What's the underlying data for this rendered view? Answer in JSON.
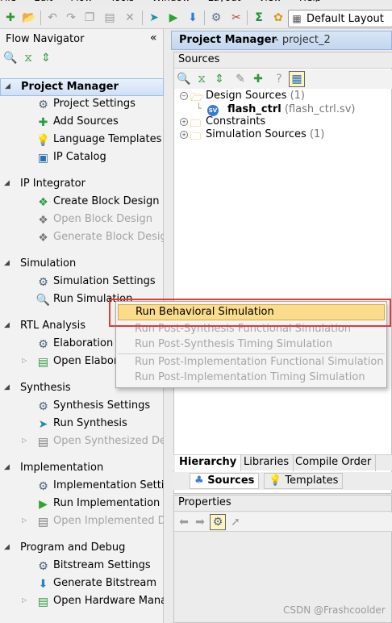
{
  "menubar": [
    "File",
    "Edit",
    "Flow",
    "Tools",
    "Window",
    "Layout",
    "View",
    "Help"
  ],
  "toolbar": {
    "layout_select": "Default Layout",
    "icons": [
      "new-project-icon",
      "open-project-icon",
      "undo-icon",
      "redo-icon",
      "copy-icon",
      "paste-icon",
      "delete-icon",
      "run-flow-icon",
      "run-icon",
      "program-icon",
      "settings-icon",
      "tools-icon",
      "sigma-icon",
      "layout-icon"
    ]
  },
  "flow_navigator": {
    "title": "Flow Navigator",
    "collapse_glyph": "«",
    "sections": [
      {
        "title": "Project Manager",
        "active": true,
        "items": [
          {
            "label": "Project Settings",
            "icon": "gear-icon",
            "enabled": true
          },
          {
            "label": "Add Sources",
            "icon": "add-sources-icon",
            "enabled": true
          },
          {
            "label": "Language Templates",
            "icon": "lightbulb-icon",
            "enabled": true
          },
          {
            "label": "IP Catalog",
            "icon": "ip-catalog-icon",
            "enabled": true
          }
        ]
      },
      {
        "title": "IP Integrator",
        "items": [
          {
            "label": "Create Block Design",
            "icon": "create-block-icon",
            "enabled": true
          },
          {
            "label": "Open Block Design",
            "icon": "open-block-icon",
            "enabled": false
          },
          {
            "label": "Generate Block Design",
            "icon": "generate-block-icon",
            "enabled": false
          }
        ]
      },
      {
        "title": "Simulation",
        "items": [
          {
            "label": "Simulation Settings",
            "icon": "gear-icon",
            "enabled": true
          },
          {
            "label": "Run Simulation",
            "icon": "magnifier-wave-icon",
            "enabled": true
          }
        ]
      },
      {
        "title": "RTL Analysis",
        "items": [
          {
            "label": "Elaboration Settings",
            "icon": "gear-icon",
            "enabled": true
          },
          {
            "label": "Open Elaborated Design",
            "icon": "open-design-icon",
            "enabled": true,
            "expandable": true
          }
        ]
      },
      {
        "title": "Synthesis",
        "items": [
          {
            "label": "Synthesis Settings",
            "icon": "gear-icon",
            "enabled": true
          },
          {
            "label": "Run Synthesis",
            "icon": "run-synthesis-icon",
            "enabled": true
          },
          {
            "label": "Open Synthesized Design",
            "icon": "open-design-icon",
            "enabled": false,
            "expandable": true
          }
        ]
      },
      {
        "title": "Implementation",
        "items": [
          {
            "label": "Implementation Settings",
            "icon": "gear-icon",
            "enabled": true
          },
          {
            "label": "Run Implementation",
            "icon": "run-icon",
            "enabled": true
          },
          {
            "label": "Open Implemented Design",
            "icon": "open-design-icon",
            "enabled": false,
            "expandable": true
          }
        ]
      },
      {
        "title": "Program and Debug",
        "items": [
          {
            "label": "Bitstream Settings",
            "icon": "gear-icon",
            "enabled": true
          },
          {
            "label": "Generate Bitstream",
            "icon": "generate-bitstream-icon",
            "enabled": true
          },
          {
            "label": "Open Hardware Manager",
            "icon": "hardware-manager-icon",
            "enabled": true,
            "expandable": true
          }
        ]
      }
    ]
  },
  "project_manager": {
    "title": "Project Manager",
    "subtitle": "- project_2",
    "sources": {
      "title": "Sources",
      "tree": [
        {
          "label": "Design Sources",
          "count": "(1)",
          "expanded": true
        },
        {
          "label": "flash_ctrl",
          "detail": "(flash_ctrl.sv)",
          "badge": "SV",
          "child": true
        },
        {
          "label": "Constraints",
          "count": "",
          "expanded": false
        },
        {
          "label": "Simulation Sources",
          "count": "(1)",
          "expanded": false
        }
      ],
      "tabs": [
        "Hierarchy",
        "Libraries",
        "Compile Order"
      ],
      "subtabs": [
        "Sources",
        "Templates"
      ]
    },
    "properties": {
      "title": "Properties"
    }
  },
  "context_menu": {
    "items": [
      {
        "label": "Run Behavioral Simulation",
        "enabled": true,
        "highlighted": true
      },
      {
        "label": "Run Post-Synthesis Functional Simulation",
        "enabled": false
      },
      {
        "label": "Run Post-Synthesis Timing Simulation",
        "enabled": false
      },
      {
        "label": "Run Post-Implementation Functional Simulation",
        "enabled": false
      },
      {
        "label": "Run Post-Implementation Timing Simulation",
        "enabled": false
      }
    ]
  },
  "watermark": "CSDN @Frashcoolder",
  "colors": {
    "accent": "#c3d6ee",
    "highlight": "#fadc8c",
    "annotation_box": "#e03a3a",
    "disabled_text": "#a3a3a3"
  }
}
